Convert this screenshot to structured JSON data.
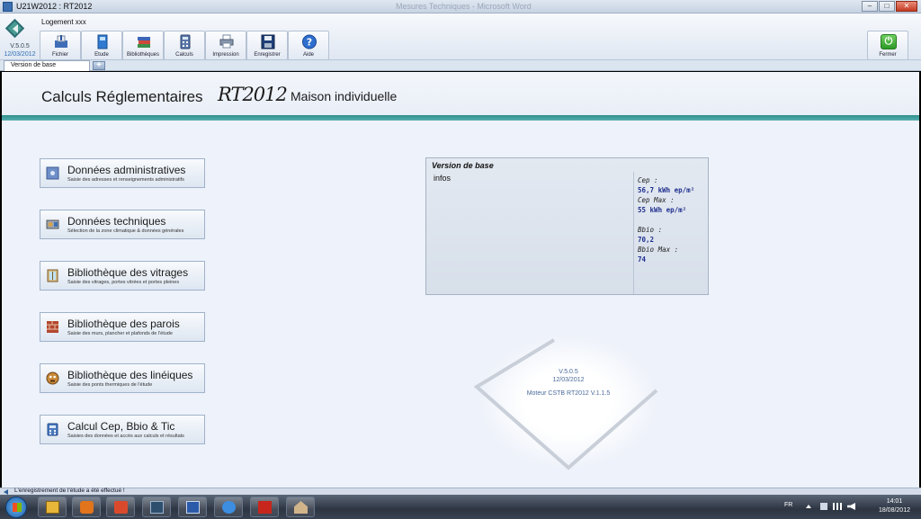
{
  "window": {
    "title": "U21W2012 : RT2012",
    "ghost_title": "Mesures Techniques - Microsoft Word"
  },
  "app": {
    "version": "V.5.0.5",
    "version_date": "12/03/2012",
    "document_title": "Logement xxx"
  },
  "toolbar": {
    "items": [
      {
        "label": "Fichier",
        "icon": "file-icon"
      },
      {
        "label": "Etude",
        "icon": "study-icon"
      },
      {
        "label": "Bibliothèques",
        "icon": "libraries-icon"
      },
      {
        "label": "Calculs",
        "icon": "calculator-icon"
      },
      {
        "label": "Impression",
        "icon": "printer-icon"
      },
      {
        "label": "Enregistrer",
        "icon": "save-icon"
      },
      {
        "label": "Aide",
        "icon": "help-icon"
      }
    ],
    "close_label": "Fermer"
  },
  "tabs": {
    "active": "Version de base",
    "add": "+"
  },
  "header": {
    "title": "Calculs Réglementaires",
    "rt": "RT2012",
    "subtitle": "Maison individuelle"
  },
  "menu": [
    {
      "title": "Données administratives",
      "desc": "Saisie des adresses et renseignements administratifs",
      "icon": "admin-icon"
    },
    {
      "title": "Données techniques",
      "desc": "Sélection de la zone climatique & données générales",
      "icon": "technical-icon"
    },
    {
      "title": "Bibliothèque des vitrages",
      "desc": "Saisie des vitrages, portes vitrées et portes pleines",
      "icon": "window-icon"
    },
    {
      "title": "Bibliothèque des parois",
      "desc": "Saisie des murs, plancher et plafonds de l'étude",
      "icon": "wall-icon"
    },
    {
      "title": "Bibliothèque des linéiques",
      "desc": "Saisie des ponts thermiques de l'étude",
      "icon": "thermal-bridge-icon"
    },
    {
      "title": "Calcul Cep, Bbio & Tic",
      "desc": "Saisies des données et accès aux calculs et résultats",
      "icon": "calc-results-icon"
    }
  ],
  "results": {
    "title": "Version de base",
    "info_label": "infos",
    "cep_label": "Cep :",
    "cep_value": "56,7 kWh ep/m²",
    "cep_max_label": "Cep Max :",
    "cep_max_value": "55 kWh ep/m²",
    "bbio_label": "Bbio :",
    "bbio_value": "70,2",
    "bbio_max_label": "Bbio Max :",
    "bbio_max_value": "74"
  },
  "splash": {
    "version": "V.5.0.5",
    "date": "12/03/2012",
    "engine": "Moteur CSTB RT2012 V.1.1.5"
  },
  "status": {
    "message": "L'enregistrement de l'étude a été effectué !"
  },
  "taskbar": {
    "lang": "FR",
    "time": "14:01",
    "date": "18/08/2012"
  },
  "colors": {
    "teal": "#2f8f8b",
    "value_blue": "#1f2f8f"
  }
}
